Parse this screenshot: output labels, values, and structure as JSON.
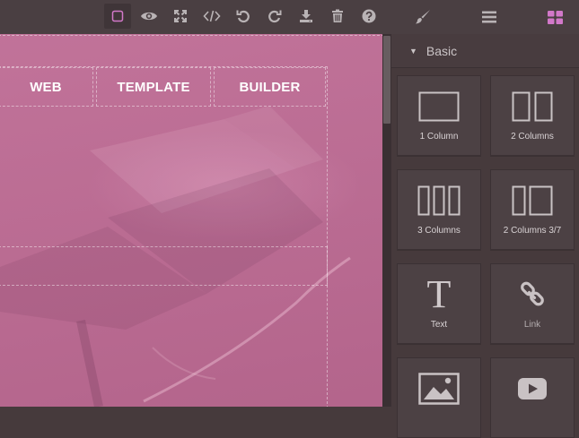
{
  "toolbar": {
    "buttons": [
      {
        "id": "sw-visibility",
        "icon": "square-outline-icon",
        "active": true
      },
      {
        "id": "preview",
        "icon": "eye-icon"
      },
      {
        "id": "fullscreen",
        "icon": "expand-arrows-icon"
      },
      {
        "id": "export-code",
        "icon": "code-icon"
      },
      {
        "id": "undo",
        "icon": "undo-icon"
      },
      {
        "id": "redo",
        "icon": "redo-icon"
      },
      {
        "id": "import",
        "icon": "download-icon"
      },
      {
        "id": "clear",
        "icon": "trash-icon"
      },
      {
        "id": "help",
        "icon": "question-circle-icon"
      }
    ],
    "panel_tabs": [
      {
        "id": "style-manager",
        "icon": "paintbrush-icon"
      },
      {
        "id": "layer-manager",
        "icon": "bars-icon"
      },
      {
        "id": "blocks",
        "icon": "th-large-icon",
        "selected": true
      }
    ],
    "accent_color": "#d278c9"
  },
  "canvas": {
    "nav": [
      "WEB",
      "TEMPLATE",
      "BUILDER"
    ],
    "background_color": "#bd6a93"
  },
  "blocks_panel": {
    "category": "Basic",
    "blocks": [
      {
        "label": "1 Column",
        "icon": "one-column-icon"
      },
      {
        "label": "2 Columns",
        "icon": "two-columns-icon"
      },
      {
        "label": "3 Columns",
        "icon": "three-columns-icon"
      },
      {
        "label": "2 Columns 3/7",
        "icon": "two-columns-3-7-icon"
      },
      {
        "label": "Text",
        "icon": "text-icon"
      },
      {
        "label": "Link",
        "icon": "link-icon"
      },
      {
        "label": "",
        "icon": "image-icon"
      },
      {
        "label": "",
        "icon": "video-icon"
      }
    ]
  }
}
